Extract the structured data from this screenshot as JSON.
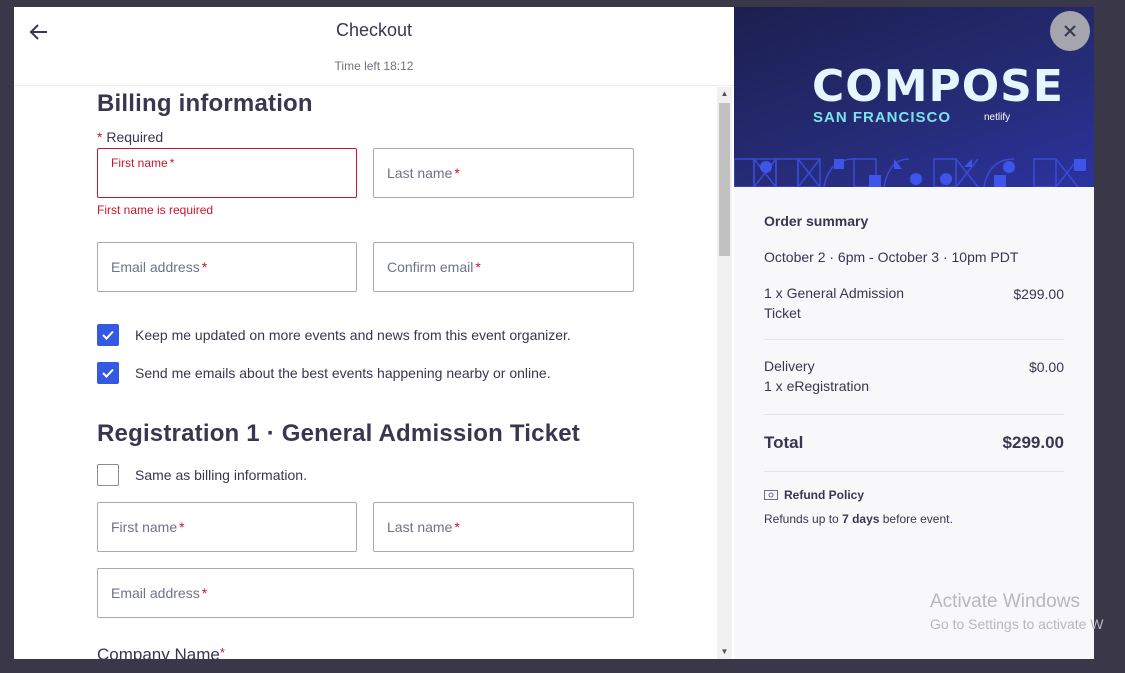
{
  "header": {
    "title": "Checkout",
    "time_left": "Time left 18:12"
  },
  "billing": {
    "heading": "Billing information",
    "required_note": "Required",
    "required_star": "*",
    "first_name_label": "First name",
    "first_name_error": "First name is required",
    "last_name_label": "Last name",
    "email_label": "Email address",
    "confirm_email_label": "Confirm email",
    "checkbox_updates": {
      "label": "Keep me updated on more events and news from this event organizer.",
      "checked": true
    },
    "checkbox_emails": {
      "label": "Send me emails about the best events happening nearby or online.",
      "checked": true
    }
  },
  "registration": {
    "heading": "Registration 1 · General Admission Ticket",
    "same_as_billing": {
      "label": "Same as billing information.",
      "checked": false
    },
    "first_name_label": "First name",
    "last_name_label": "Last name",
    "email_label": "Email address",
    "company_label": "Company Name"
  },
  "event": {
    "logo_text": "COMPOSE",
    "logo_sub": "SAN FRANCISCO",
    "logo_brand": "netlify"
  },
  "order": {
    "title": "Order summary",
    "date": "October 2 · 6pm - October 3 · 10pm PDT",
    "ticket_line1": "1 x General Admission",
    "ticket_line2": "Ticket",
    "ticket_price": "$299.00",
    "delivery_line1": "Delivery",
    "delivery_line2": "1 x eRegistration",
    "delivery_price": "$0.00",
    "total_label": "Total",
    "total_value": "$299.00",
    "refund_title": "Refund Policy",
    "refund_pre": "Refunds up to ",
    "refund_days": "7 days",
    "refund_post": " before event."
  },
  "watermark": {
    "line1": "Activate Windows",
    "line2": "Go to Settings to activate W"
  },
  "colors": {
    "accent": "#3659e3",
    "error": "#c5162e",
    "text": "#39364f",
    "banner": "#242a6e"
  }
}
